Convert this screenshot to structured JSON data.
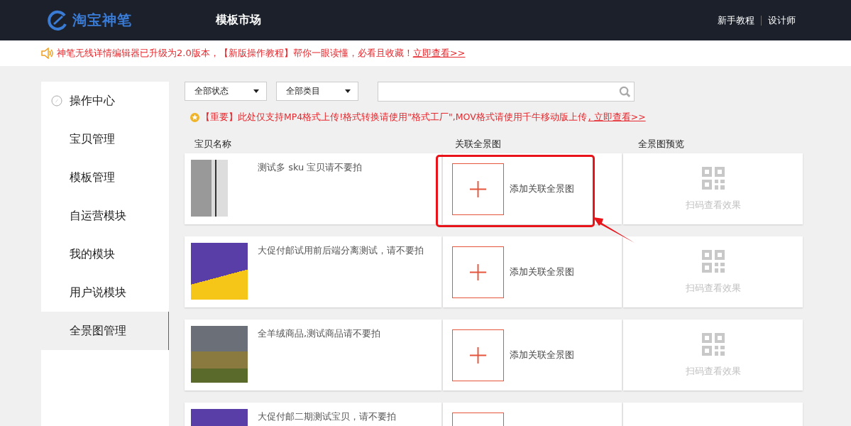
{
  "header": {
    "brand": "淘宝神笔",
    "nav_title": "模板市场",
    "links": [
      "新手教程",
      "设计师"
    ]
  },
  "notice": {
    "text": "神笔无线详情编辑器已升级为2.0版本，【新版操作教程】帮你一眼读懂，必看且收藏！",
    "link": "立即查看>>"
  },
  "sidebar": {
    "items": [
      {
        "label": "操作中心",
        "kind": "heading",
        "selected": false
      },
      {
        "label": "宝贝管理",
        "kind": "item",
        "selected": false
      },
      {
        "label": "模板管理",
        "kind": "item",
        "selected": false
      },
      {
        "label": "自运营模块",
        "kind": "item",
        "selected": false
      },
      {
        "label": "我的模块",
        "kind": "item",
        "selected": false
      },
      {
        "label": "用户说模块",
        "kind": "item",
        "selected": false
      },
      {
        "label": "全景图管理",
        "kind": "item",
        "selected": true
      }
    ]
  },
  "filters": [
    {
      "value": "全部状态"
    },
    {
      "value": "全部类目"
    }
  ],
  "tip": {
    "text": "【重要】此处仅支持MP4格式上传!格式转换请使用\"格式工厂\",MOV格式请使用千牛移动版上传",
    "link": ", 立即查看>>"
  },
  "table": {
    "columns": [
      "宝贝名称",
      "关联全景图",
      "全景图预览"
    ],
    "rows": [
      {
        "name": "测试多 sku 宝贝请不要拍",
        "kind": "label",
        "link_action": "添加关联全景图",
        "preview_label": "扫码查看效果",
        "highlighted": true
      },
      {
        "name": "大促付邮试用前后端分离测试，请不要拍",
        "kind": "poster",
        "link_action": "添加关联全景图",
        "preview_label": "扫码查看效果",
        "highlighted": false
      },
      {
        "name": "全羊绒商品,测试商品请不要拍",
        "kind": "building",
        "link_action": "添加关联全景图",
        "preview_label": "扫码查看效果",
        "highlighted": false
      },
      {
        "name": "大促付邮二期测试宝贝，请不要拍",
        "kind": "poster",
        "highlighted": false
      }
    ]
  }
}
